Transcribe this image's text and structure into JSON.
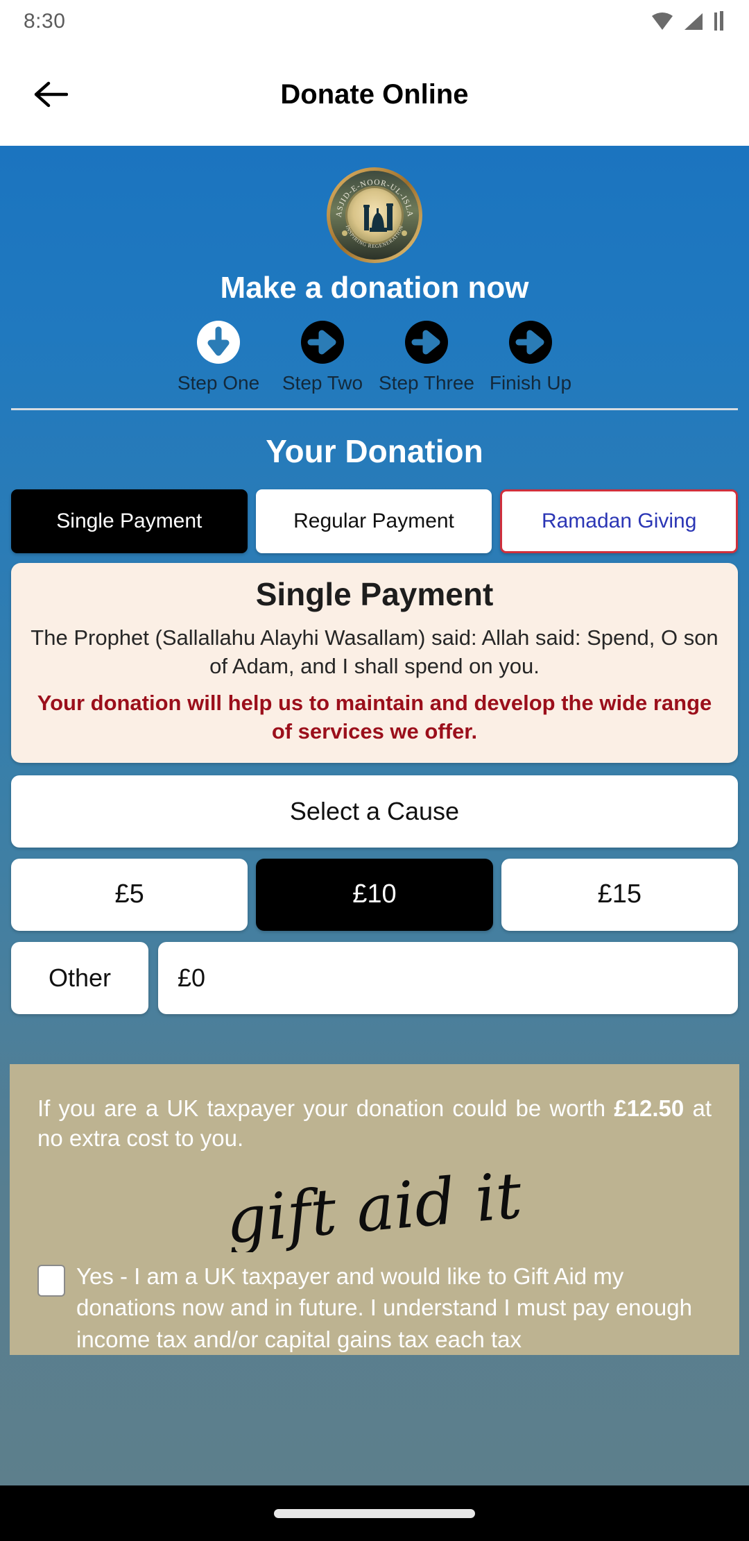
{
  "status_bar": {
    "time": "8:30",
    "icons": [
      "wifi-icon",
      "signal-icon",
      "battery-icon"
    ]
  },
  "app_bar": {
    "back_icon": "back-arrow-icon",
    "title": "Donate Online"
  },
  "hero": {
    "logo": {
      "icon": "masjid-logo-icon",
      "top_arc_text": "MASJID-E-NOOR-UL-ISLAM",
      "bottom_arc_text": "INSPIRING REGENERATION"
    },
    "headline": "Make a donation now"
  },
  "steps": [
    {
      "label": "Step One",
      "icon": "arrow-down-circle-icon",
      "active": true
    },
    {
      "label": "Step Two",
      "icon": "arrow-right-circle-icon",
      "active": false
    },
    {
      "label": "Step Three",
      "icon": "arrow-right-circle-icon",
      "active": false
    },
    {
      "label": "Finish Up",
      "icon": "arrow-right-circle-icon",
      "active": false
    }
  ],
  "section": {
    "title": "Your Donation"
  },
  "tabs": [
    {
      "label": "Single Payment",
      "state": "active"
    },
    {
      "label": "Regular Payment",
      "state": "default"
    },
    {
      "label": "Ramadan Giving",
      "state": "outlined"
    }
  ],
  "info_card": {
    "title": "Single Payment",
    "quote": "The Prophet (Sallallahu Alayhi Wasallam) said: Allah said: Spend, O son of Adam, and I shall spend on you.",
    "note": "Your donation will help us to maintain and develop the wide range of services we offer."
  },
  "cause_select": {
    "label": "Select a Cause"
  },
  "amounts": [
    {
      "label": "£5",
      "selected": false
    },
    {
      "label": "£10",
      "selected": true
    },
    {
      "label": "£15",
      "selected": false
    }
  ],
  "other": {
    "button_label": "Other",
    "input_value": "£0"
  },
  "gift_aid": {
    "text_before": "If you are a UK taxpayer your donation could be worth ",
    "amount": "£12.50",
    "text_after": " at no extra cost to you.",
    "logo_text": "gift aid it",
    "checkbox_checked": false,
    "consent": "Yes - I am a UK taxpayer and would like to Gift Aid my donations now and in future. I understand I must pay enough income tax and/or capital gains tax each tax"
  },
  "nav_bar": {
    "home_indicator": "home-indicator"
  },
  "colors": {
    "top_blue": "#1b74bf",
    "bottom_slate": "#5d7f8c",
    "card_cream": "#fbefe5",
    "note_red": "#9b0f1b",
    "tab_outline_red": "#d0303c",
    "tab_outline_text": "#2b36b5",
    "giftaid_tan": "#bdb391"
  }
}
